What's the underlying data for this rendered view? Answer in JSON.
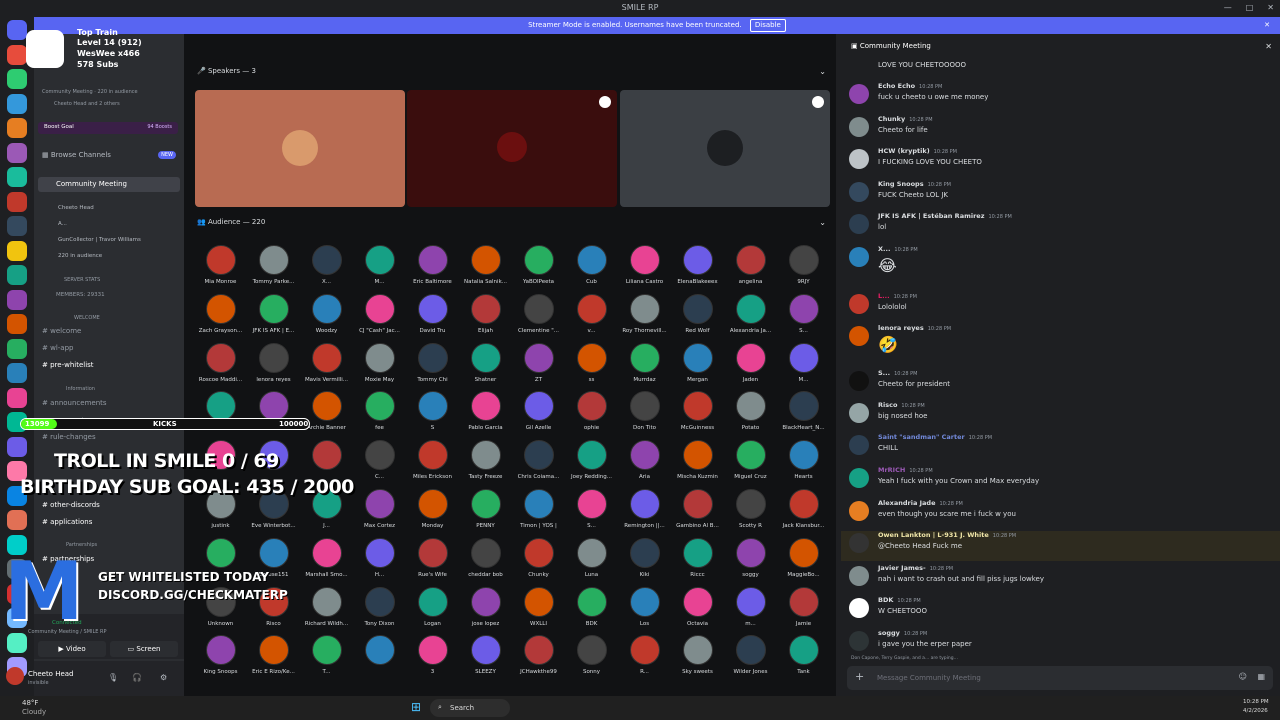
{
  "window": {
    "title": "SMILE RP"
  },
  "streamer": {
    "text": "Streamer Mode is enabled. Usernames have been truncated.",
    "disable": "Disable"
  },
  "overlay": {
    "top_train": "Top Train",
    "level": "Level 14 (912)",
    "weswee": "WesWee x466",
    "subs": "578 Subs",
    "kicks": "KICKS",
    "kicks_left": "13099",
    "kicks_right": "100000",
    "troll": "TROLL IN SMILE  0 / 69",
    "birthday": "BIRTHDAY SUB GOAL:  435 / 2000",
    "whitelist1": "GET WHITELISTED TODAY",
    "whitelist2": "DISCORD.GG/CHECKMATERP"
  },
  "sidebar": {
    "live": "Community Meeting · 220 in audience",
    "live2": "Cheeto Head and 2 others",
    "boost": "Boost Goal",
    "boosts": "94 Boosts",
    "browse": "Browse Channels",
    "new": "NEW",
    "meeting": "Community Meeting",
    "voice": [
      "Cheeto Head",
      "A...",
      "GunCollector | Travor Williams"
    ],
    "in_audience": "220 in audience",
    "server_stats": "SERVER STATS",
    "members": "MEMBERS: 29331",
    "welcome_cat": "WELCOME",
    "channels": [
      "welcome",
      "wl-app",
      "pre-whitelist"
    ],
    "info_cat": "Information",
    "info_channels": [
      "announcements",
      "server-rules",
      "rule-changes"
    ],
    "other": [
      "other-discords",
      "applications"
    ],
    "partnerships": "Partnerships",
    "partner": "partnerships",
    "voice_connected": "Connected",
    "voice_sub": "Community Meeting / SMILE RP",
    "video": "Video",
    "screen": "Screen",
    "user": "Cheeto Head",
    "status": "invisible"
  },
  "stage": {
    "speakers": "Speakers — 3",
    "audience": "Audience — 220",
    "names": [
      [
        "Mia Monroe",
        "Tommy Parke...",
        "X...",
        "M...",
        "Eric Baltimore",
        "Natalia Salnik...",
        "YaBOIPeeta",
        "Cub",
        "Liliana Castro",
        "ElenaBlakeeex",
        "angelina",
        "9RJY"
      ],
      [
        "Zach Grayson...",
        "JFK IS AFK | E...",
        "Woodzy",
        "CJ \"Cash\" Jac...",
        "David Tru",
        "Elijah",
        "Clementine \"...",
        "v...",
        "Roy Thornevill...",
        "Red Wolf",
        "Alexandria Ja...",
        "S..."
      ],
      [
        "Roscoe Maddi...",
        "lenora reyes",
        "Mavis Vermilli...",
        "Moxie May",
        "Tommy Chi",
        "Shatner",
        "ZT",
        "ss",
        "Murrdaz",
        "Mergan",
        "Jaden",
        "M..."
      ],
      [
        "",
        "Spanish",
        "Archie Banner",
        "fee",
        "S",
        "Pablo Garcia",
        "Gil Azelle",
        "ophie",
        "Don Tito",
        "McGuinness",
        "Potato",
        "BlackHeart_N..."
      ],
      [
        "",
        "",
        "",
        "C...",
        "Miles Erickson",
        "Tasty Freeze",
        "Chris Coiama...",
        "Joey Redding...",
        "Aria",
        "Mischa Kuzmin",
        "Miguel Cruz",
        "Hearts"
      ],
      [
        "justink",
        "Eve Winterbot...",
        "J...",
        "Max Cortez",
        "Monday",
        "PENNY",
        "Timon | YOS |",
        "S...",
        "Remington ||...",
        "Gambino Al B...",
        "Scotty R",
        "Jack Klansbur..."
      ],
      [
        "",
        "Excuse151",
        "Marshall Smo...",
        "H...",
        "Rue's Wife",
        "cheddar bob",
        "Chunky",
        "Luna",
        "Kiki",
        "Riccc",
        "soggy",
        "MaggieBo..."
      ],
      [
        "Unknown",
        "Risco",
        "Richard Wildh...",
        "Tony Dixon",
        "Logan",
        "jose lopez",
        "WXLLI",
        "BDK",
        "Los",
        "Octavia",
        "m...",
        "Jamie"
      ],
      [
        "King Snoops",
        "Eric E Rizo/Ke...",
        "T...",
        "",
        "3",
        "SLEEZY",
        "JCHawkthe99",
        "Sonny",
        "R...",
        "Sky sweets",
        "Wilder Jones",
        "Tank",
        "PathiTheBob"
      ]
    ]
  },
  "chat": {
    "title": "Community Meeting",
    "placeholder": "Message Community Meeting",
    "typing": "Don Capone, Terry Gaspie, and a... are typing...",
    "messages": [
      {
        "author": "",
        "text": "LOVE YOU CHEETOOOOO",
        "time": "",
        "color": "#dbdee1"
      },
      {
        "author": "Echo Echo",
        "text": "fuck u cheeto u owe me money",
        "time": "10:28 PM",
        "color": "#dbdee1"
      },
      {
        "author": "Chunky",
        "text": "Cheeto for life",
        "time": "10:28 PM",
        "color": "#dbdee1"
      },
      {
        "author": "HCW (kryptik)",
        "text": "I FUCKING LOVE YOU CHEETO",
        "time": "10:28 PM",
        "color": "#dbdee1"
      },
      {
        "author": "King Snoops",
        "text": "FUCK Cheeto LOL JK",
        "time": "10:28 PM",
        "color": "#dbdee1"
      },
      {
        "author": "JFK IS AFK | Estéban Ramirez",
        "text": "lol",
        "time": "10:28 PM",
        "color": "#dbdee1"
      },
      {
        "author": "X...",
        "text": "😂",
        "time": "10:28 PM",
        "color": "#dbdee1"
      },
      {
        "author": "L...",
        "text": "Lolololol",
        "time": "10:28 PM",
        "color": "#e91e63"
      },
      {
        "author": "lenora reyes",
        "text": "🤣",
        "time": "10:28 PM",
        "color": "#dbdee1"
      },
      {
        "author": "S...",
        "text": "Cheeto for president",
        "time": "10:28 PM",
        "color": "#dbdee1"
      },
      {
        "author": "Risco",
        "text": "big nosed hoe",
        "time": "10:28 PM",
        "color": "#dbdee1"
      },
      {
        "author": "Saint \"sandman\" Carter",
        "text": "CHILL",
        "time": "10:28 PM",
        "color": "#7289da"
      },
      {
        "author": "MrRICH",
        "text": "Yeah I fuck with you Crown and Max everyday",
        "time": "10:28 PM",
        "color": "#9b59b6"
      },
      {
        "author": "Alexandria Jade",
        "text": "even though you scare me i fuck w you",
        "time": "10:28 PM",
        "color": "#dbdee1"
      },
      {
        "author": "Owen Lankton | L-931 J. White",
        "text": "@Cheeto Head Fuck me",
        "time": "10:28 PM",
        "color": "#f0e6a8"
      },
      {
        "author": "Javier James-",
        "text": "nah i want to crash out and fill piss jugs lowkey",
        "time": "10:28 PM",
        "color": "#dbdee1"
      },
      {
        "author": "BDK",
        "text": "W CHEETOOO",
        "time": "10:28 PM",
        "color": "#dbdee1"
      },
      {
        "author": "soggy",
        "text": "i gave you the erper paper",
        "time": "10:28 PM",
        "color": "#dbdee1"
      }
    ]
  },
  "taskbar": {
    "weather": "48°F",
    "weather2": "Cloudy",
    "search": "Search",
    "time": "10:28 PM",
    "date": "4/2/2026"
  }
}
